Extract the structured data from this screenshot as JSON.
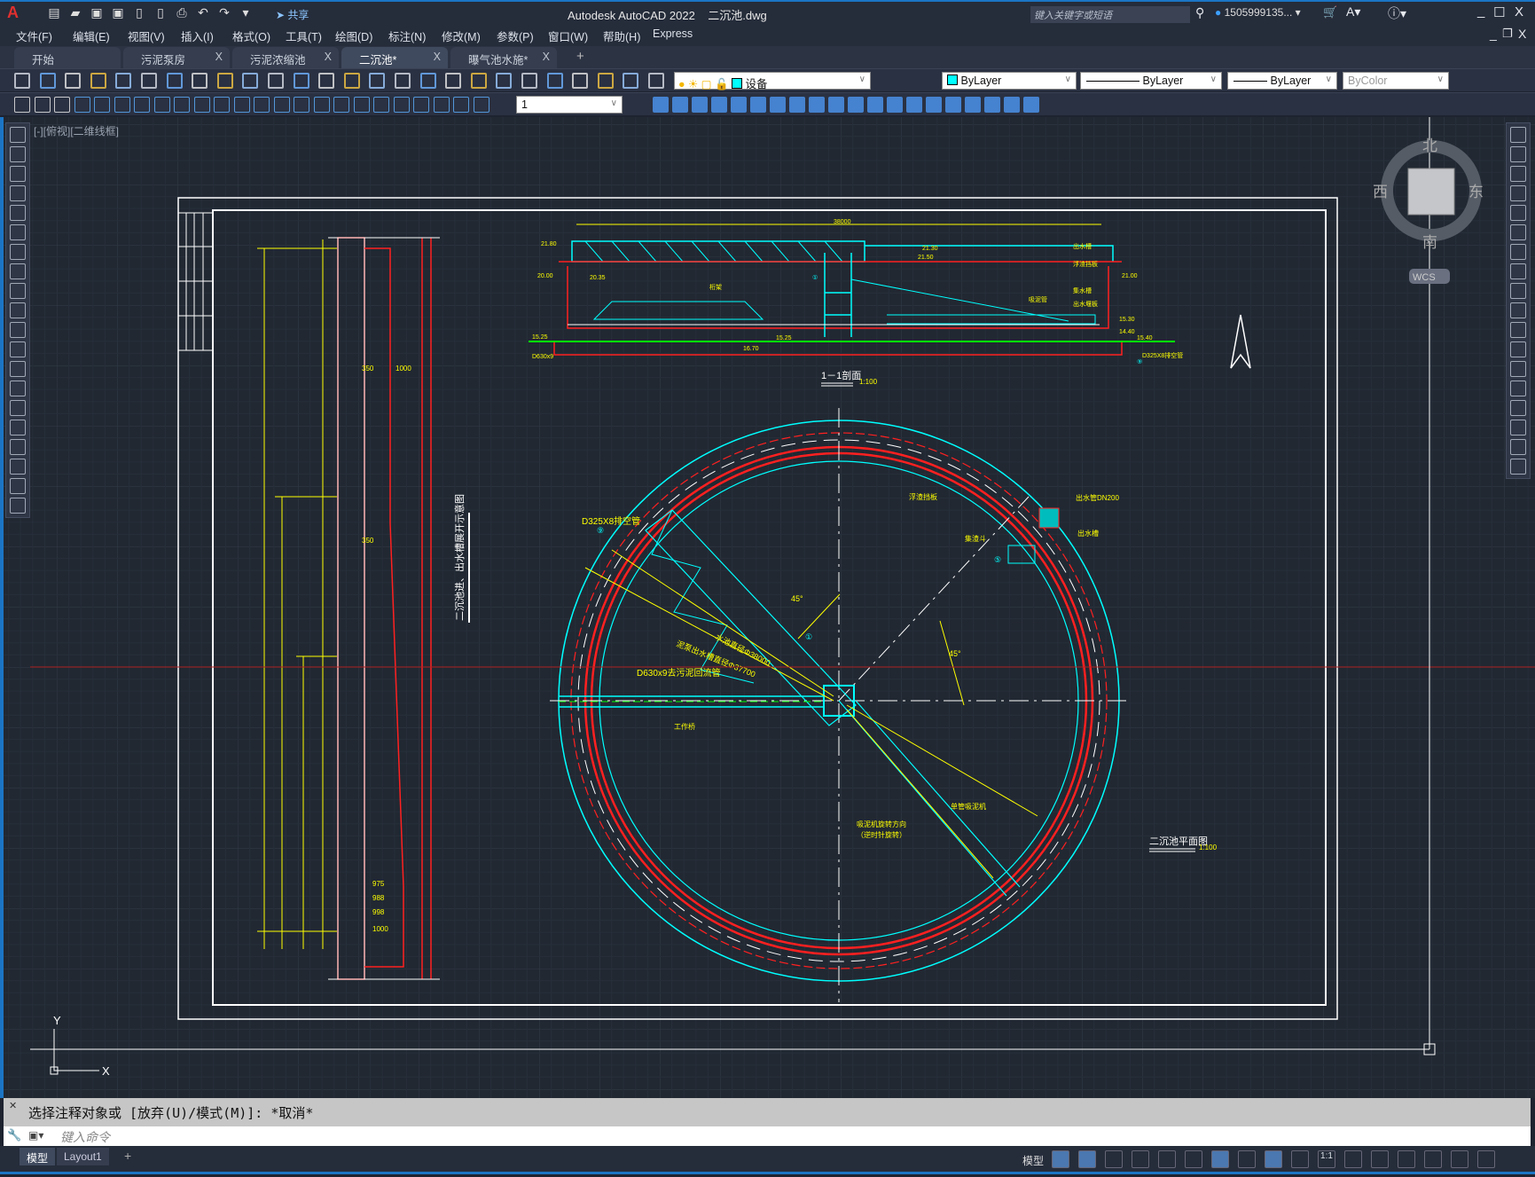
{
  "app": {
    "title": "Autodesk AutoCAD 2022    二沉池.dwg",
    "share": "共享",
    "search_placeholder": "键入关键字或短语",
    "user": "1505999135...",
    "window_controls": [
      "minimize",
      "maximize",
      "close"
    ]
  },
  "menu": [
    "文件(F)",
    "编辑(E)",
    "视图(V)",
    "插入(I)",
    "格式(O)",
    "工具(T)",
    "绘图(D)",
    "标注(N)",
    "修改(M)",
    "参数(P)",
    "窗口(W)",
    "帮助(H)",
    "Express"
  ],
  "tabs": [
    {
      "label": "开始",
      "closable": false
    },
    {
      "label": "污泥泵房",
      "closable": true
    },
    {
      "label": "污泥浓缩池",
      "closable": true
    },
    {
      "label": "二沉池*",
      "closable": true,
      "active": true
    },
    {
      "label": "曝气池水施*",
      "closable": true
    }
  ],
  "tab_close": "X",
  "tab_add": "+",
  "toolbar": {
    "layer": "设备",
    "layer_color": "#00ffff",
    "color": "ByLayer",
    "linetype": "ByLayer",
    "lineweight": "ByLayer",
    "plotstyle": "ByColor",
    "dimscale": "1"
  },
  "viewport_label": "[-][俯视][二维线框]",
  "viewcube": {
    "north": "北",
    "south": "南",
    "east": "东",
    "west": "西",
    "wcs": "WCS"
  },
  "ucs": {
    "x": "X",
    "y": "Y"
  },
  "drawing": {
    "section_title": "1－1剖面",
    "section_scale": "1:100",
    "section_span": "38000",
    "section_labels": [
      "21.80",
      "21.30",
      "21.50",
      "20.00",
      "21.00",
      "20.35",
      "15.25",
      "15.30",
      "14.40",
      "15.40",
      "16.70",
      "15.25",
      "桁架",
      "吸泥管",
      "出水槽",
      "浮渣挡板",
      "集水槽",
      "出水堰板",
      "D630x9",
      "D325X8排空管",
      "①",
      "⑨"
    ],
    "plan_title": "二沉池平面图",
    "plan_scale": "1:100",
    "plan_labels": {
      "drain": "D325X8排空管",
      "inlet": "D630x9去污泥回流管",
      "dia1": "水池直径Φ38000",
      "dia2": "泥泵出水槽直径Φ37700",
      "angle1": "45°",
      "angle2": "45°",
      "bridge": "工作桥",
      "scraper": "单管吸泥机",
      "rotation": "吸泥机旋转方向",
      "rotation2": "（逆时针旋转）",
      "baffle": "浮渣挡板",
      "hopper": "集渣斗",
      "outlet": "出水槽",
      "pipe": "出水管DN200",
      "num1": "①",
      "num5": "⑤",
      "num9": "⑨"
    },
    "wall_title": "二沉池进、出水槽展开示意图",
    "wall_dims": [
      "975",
      "988",
      "998",
      "1000",
      "350",
      "350",
      "1000"
    ]
  },
  "command": {
    "history": "选择注释对象或 [放弃(U)/模式(M)]: *取消*",
    "placeholder": "键入命令"
  },
  "layout_tabs": [
    "模型",
    "Layout1"
  ],
  "status": {
    "model": "模型",
    "scale": "1:1"
  },
  "colors": {
    "accent": "#1b75c4",
    "canvas": "#212832",
    "red": "#ff0000",
    "cyan": "#00ffff",
    "yellow": "#ffff00",
    "green": "#00ff00"
  },
  "icons": {
    "quick": [
      "new-icon",
      "open-icon",
      "save-icon",
      "saveas-icon",
      "open-web-icon",
      "save-web-icon",
      "plot-icon",
      "undo-icon",
      "redo-icon",
      "customize-icon"
    ],
    "tb1": [
      "new-icon",
      "open-icon",
      "save-icon",
      "plot-icon",
      "preview-icon",
      "publish-icon",
      "3d-print-icon",
      "cut-icon",
      "copy-icon",
      "paste-icon",
      "matchprop-icon",
      "block-edit-icon",
      "undo-icon",
      "redo-icon",
      "pan-icon",
      "zoom-realtime-icon",
      "zoom-window-icon",
      "zoom-previous-icon",
      "properties-icon",
      "design-center-icon",
      "tool-palette-icon",
      "sheetset-icon",
      "markup-icon",
      "calculator-icon",
      "help-icon",
      "layer-manager-icon"
    ],
    "tb2": [
      "dim-style-icon",
      "dim-check-icon",
      "dim-erase-icon",
      "linear-dim-icon",
      "aligned-dim-icon",
      "arc-length-icon",
      "ordinate-icon",
      "radius-icon",
      "jogged-icon",
      "diameter-icon",
      "angular-icon",
      "quick-dim-icon",
      "baseline-icon",
      "continue-icon",
      "space-icon",
      "break-icon",
      "tolerance-icon",
      "center-mark-icon",
      "inspect-icon",
      "jog-line-icon",
      "dim-edit-icon",
      "dim-text-edit-icon",
      "dim-update-icon",
      "dimscale-icon"
    ],
    "left": [
      "line-icon",
      "construction-line-icon",
      "polyline-icon",
      "polygon-icon",
      "rectangle-icon",
      "arc-icon",
      "circle-icon",
      "revcloud-icon",
      "spline-icon",
      "ellipse-icon",
      "ellipse-arc-icon",
      "insert-block-icon",
      "make-block-icon",
      "point-icon",
      "hatch-icon",
      "gradient-icon",
      "region-icon",
      "table-icon",
      "mtext-icon",
      "add-selected-icon"
    ],
    "right": [
      "erase-icon",
      "copy-icon",
      "mirror-icon",
      "offset-icon",
      "array-icon",
      "move-icon",
      "rotate-icon",
      "scale-icon",
      "stretch-icon",
      "trim-icon",
      "extend-icon",
      "break-at-point-icon",
      "break-icon",
      "join-icon",
      "chamfer-icon",
      "fillet-icon",
      "blend-icon",
      "explode-icon"
    ],
    "status": [
      "grid-icon",
      "snap-icon",
      "ortho-icon",
      "polar-icon",
      "isodraft-icon",
      "osnap-track-icon",
      "osnap-icon",
      "lineweight-icon",
      "annotation-visibility-icon",
      "auto-scale-icon",
      "annotation-scale-icon",
      "workspace-icon",
      "plus-icon",
      "units-icon",
      "quick-properties-icon",
      "fullscreen-icon",
      "customize-icon"
    ]
  }
}
